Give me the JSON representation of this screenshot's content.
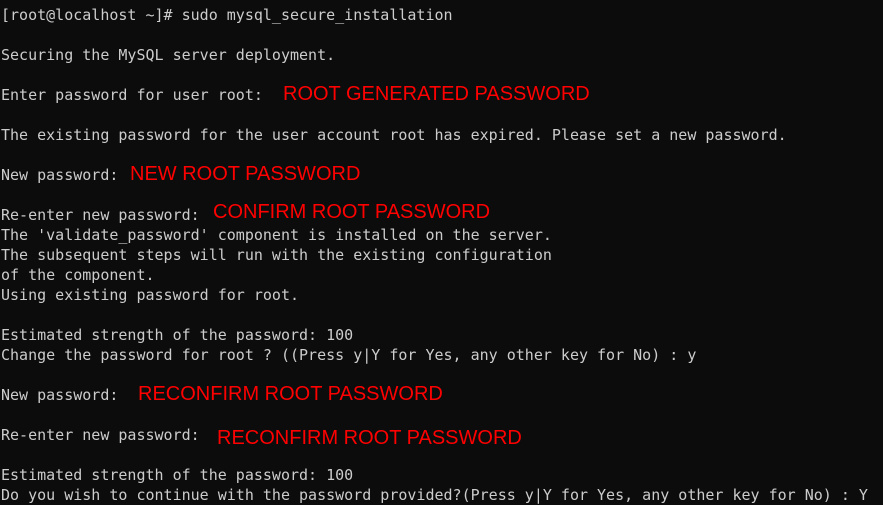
{
  "terminal": {
    "lines": [
      "[root@localhost ~]# sudo mysql_secure_installation",
      "Securing the MySQL server deployment.",
      "Enter password for user root:",
      "The existing password for the user account root has expired. Please set a new password.",
      "New password:",
      "Re-enter new password:",
      "The 'validate_password' component is installed on the server.",
      "The subsequent steps will run with the existing configuration",
      "of the component.",
      "Using existing password for root.",
      "Estimated strength of the password: 100",
      "Change the password for root ? ((Press y|Y for Yes, any other key for No) : y",
      "New password:",
      "Re-enter new password:",
      "Estimated strength of the password: 100",
      "Do you wish to continue with the password provided?(Press y|Y for Yes, any other key for No) : Y"
    ]
  },
  "annotations": {
    "root_generated": "ROOT GENERATED PASSWORD",
    "new_root": "NEW ROOT PASSWORD",
    "confirm_root": "CONFIRM ROOT PASSWORD",
    "reconfirm_1": "RECONFIRM ROOT PASSWORD",
    "reconfirm_2": "RECONFIRM ROOT PASSWORD"
  },
  "colors": {
    "background": "#0c0c0c",
    "text": "#cccccc",
    "annotation": "#ff0000"
  }
}
